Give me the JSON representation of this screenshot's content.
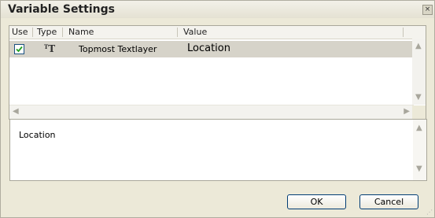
{
  "window": {
    "title": "Variable Settings",
    "close_glyph": "×"
  },
  "table": {
    "columns": [
      "Use",
      "Type",
      "Name",
      "Value"
    ],
    "rows": [
      {
        "use_checked": true,
        "type_icon": "text-layer-icon",
        "type_glyph": "T",
        "name": "Topmost Textlayer",
        "value": "Location"
      }
    ]
  },
  "value_editor": {
    "text": "Location"
  },
  "buttons": {
    "ok": "OK",
    "cancel": "Cancel"
  }
}
